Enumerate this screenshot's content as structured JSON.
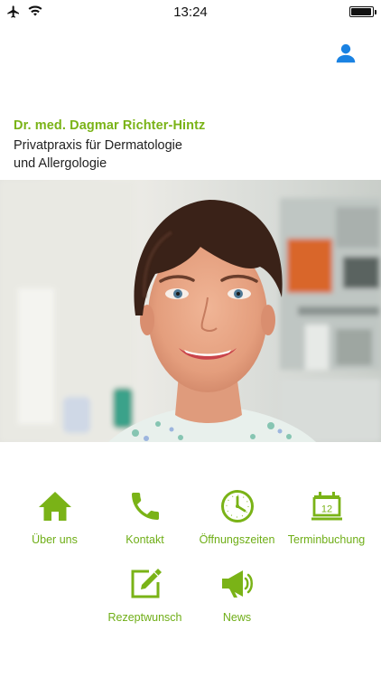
{
  "status_bar": {
    "time": "13:24",
    "battery_level": 0.95
  },
  "header": {
    "doctor_name": "Dr. med. Dagmar Richter-Hintz",
    "practice_line1": "Privatpraxis für Dermatologie",
    "practice_line2": "und Allergologie"
  },
  "colors": {
    "accent_green": "#7ab317",
    "profile_blue": "#1a82e2"
  },
  "nav": {
    "about": {
      "label": "Über uns",
      "icon": "home-icon"
    },
    "contact": {
      "label": "Kontakt",
      "icon": "phone-icon"
    },
    "hours": {
      "label": "Öffnungszeiten",
      "icon": "clock-icon"
    },
    "appointment": {
      "label": "Terminbuchung",
      "icon": "calendar-icon",
      "calendar_day": "12"
    },
    "prescription": {
      "label": "Rezeptwunsch",
      "icon": "pen-square-icon"
    },
    "news": {
      "label": "News",
      "icon": "megaphone-icon"
    }
  }
}
